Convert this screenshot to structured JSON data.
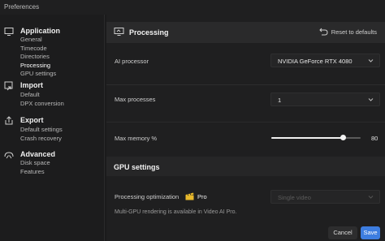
{
  "window": {
    "title": "Preferences"
  },
  "sidebar": {
    "sections": [
      {
        "label": "Application",
        "icon": "monitor-icon",
        "items": [
          "General",
          "Timecode",
          "Directories",
          "Processing",
          "GPU settings"
        ],
        "active_item": "Processing"
      },
      {
        "label": "Import",
        "icon": "import-icon",
        "items": [
          "Default",
          "DPX conversion"
        ]
      },
      {
        "label": "Export",
        "icon": "export-icon",
        "items": [
          "Default settings",
          "Crash recovery"
        ]
      },
      {
        "label": "Advanced",
        "icon": "advanced-icon",
        "items": [
          "Disk space",
          "Features"
        ]
      }
    ]
  },
  "panel": {
    "title": "Processing",
    "reset_label": "Reset to defaults",
    "ai_processor": {
      "label": "AI processor",
      "value": "NVIDIA GeForce RTX 4080"
    },
    "max_processes": {
      "label": "Max processes",
      "value": "1"
    },
    "max_memory": {
      "label": "Max memory %",
      "value": "80",
      "fraction": 0.8
    },
    "gpu_settings": {
      "title": "GPU settings",
      "processing_optimization": {
        "label": "Processing optimization",
        "badge": "Pro",
        "placeholder": "Single video"
      },
      "note": "Multi-GPU rendering is available in Video AI Pro."
    }
  },
  "footer": {
    "cancel_label": "Cancel",
    "save_label": "Save"
  },
  "colors": {
    "accent": "#3d7de0",
    "background": "#1b1b1c",
    "panel": "#1f1f20"
  }
}
